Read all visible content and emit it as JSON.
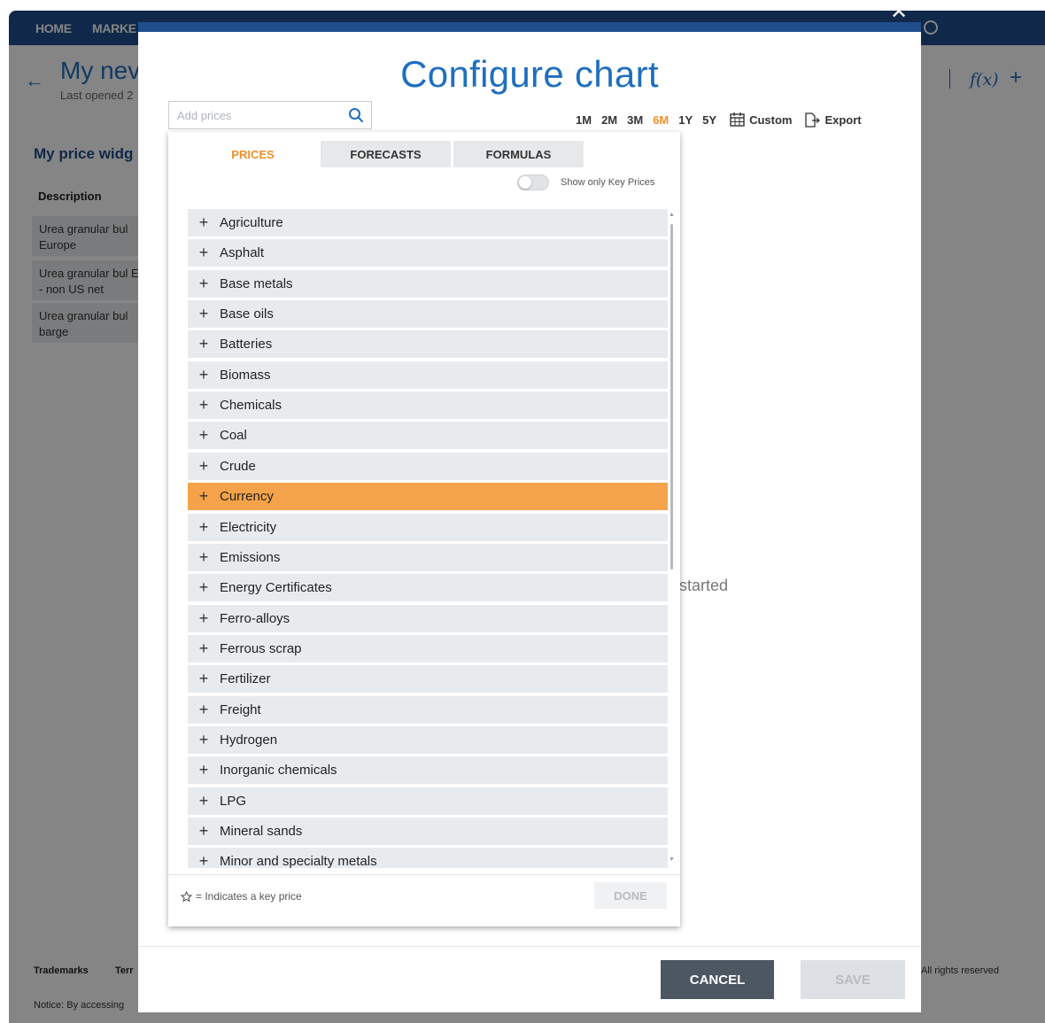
{
  "app": {
    "nav": {
      "home": "HOME",
      "markets": "MARKE"
    },
    "title": "My nev",
    "last_opened": "Last opened 2",
    "widget_heading": "My price widg",
    "description_heading": "Description",
    "description_rows": [
      "Urea granular bul Europe",
      "Urea granular bul East - non US net",
      "Urea granular bul barge"
    ],
    "get_started": "started",
    "footer": {
      "trademarks": "Trademarks",
      "terms": "Terr",
      "rights": "All rights reserved",
      "notice": "Notice: By accessing"
    }
  },
  "modal": {
    "title": "Configure chart",
    "search": {
      "placeholder": "Add prices"
    },
    "ranges": [
      "1M",
      "2M",
      "3M",
      "6M",
      "1Y",
      "5Y"
    ],
    "active_range": "6M",
    "custom_label": "Custom",
    "export_label": "Export",
    "tabs": [
      "PRICES",
      "FORECASTS",
      "FORMULAS"
    ],
    "active_tab": "PRICES",
    "key_prices_toggle": "Show only Key Prices",
    "categories": [
      "Agriculture",
      "Asphalt",
      "Base metals",
      "Base oils",
      "Batteries",
      "Biomass",
      "Chemicals",
      "Coal",
      "Crude",
      "Currency",
      "Electricity",
      "Emissions",
      "Energy Certificates",
      "Ferro-alloys",
      "Ferrous scrap",
      "Fertilizer",
      "Freight",
      "Hydrogen",
      "Inorganic chemicals",
      "LPG",
      "Mineral sands",
      "Minor and specialty metals"
    ],
    "highlighted_category": "Currency",
    "key_legend": "= Indicates a key price",
    "done_label": "DONE",
    "cancel_label": "CANCEL",
    "save_label": "SAVE"
  },
  "colors": {
    "brand_blue": "#1f4e8c",
    "title_blue": "#1f6fbf",
    "accent_orange": "#f0902a",
    "highlight_orange": "#f5a34a",
    "cancel_dark": "#4d5762"
  }
}
